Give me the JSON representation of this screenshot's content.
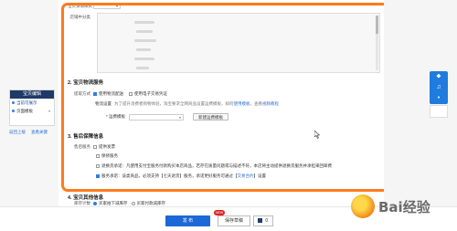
{
  "sidebar": {
    "header": "宝贝编辑",
    "items": [
      {
        "label": "当前可展示"
      },
      {
        "label": "页面模板"
      }
    ],
    "links": [
      "返回上级",
      "查看关键"
    ]
  },
  "form": {
    "detail_style_label": "宝贝详情样式",
    "sku_label": "店铺中分类",
    "section2_title": "2. 宝贝物流服务",
    "ship_method_label": "提取方式",
    "ship_opt1": "使用物流配送",
    "ship_opt2": "使用电子交易凭证",
    "logistics_label": "物流设置",
    "logistics_note": "为了提升消费者购物体验，淘宝要求全网商品设置运费模板，如何",
    "logistics_link1": "使用模板",
    "logistics_sep": "，查看",
    "logistics_link2": "视频教程",
    "template_label": "* 运费模板",
    "new_template_btn": "新建运费模板",
    "section3_title": "3. 售后保障信息",
    "aftersale_label": "售后服务",
    "as_opt1": "提供发票",
    "as_opt2": "保修服务",
    "as_opt3": "退换货承诺：凡使用支付宝服务付款购买本店商品，若存在质量问题或与描述不符，本店将主动提供退换货服务并承担来回邮费",
    "as_opt4_pre": "服务承诺：该类商品，必须支持【七天退货】服务，承诺更好服务可通过【",
    "as_opt4_link": "交易合约",
    "as_opt4_post": "】设置",
    "section4_title": "4. 宝贝其他信息",
    "stock_label": "库存计数",
    "stock_opt1": "买家拍下减库存",
    "stock_opt2": "买家付款减库存"
  },
  "bottom": {
    "publish": "发 布",
    "save_draft": "保存草稿",
    "badge": "NEW",
    "count": "0"
  },
  "watermark": "Bai经验",
  "colors": {
    "highlight": "#ff7a1a",
    "primary": "#1e67d6",
    "sidebar_header": "#1f3a66"
  },
  "icons": [
    "chevron-down-icon",
    "drop-icon",
    "bell-icon",
    "cursor-icon",
    "box-icon"
  ]
}
